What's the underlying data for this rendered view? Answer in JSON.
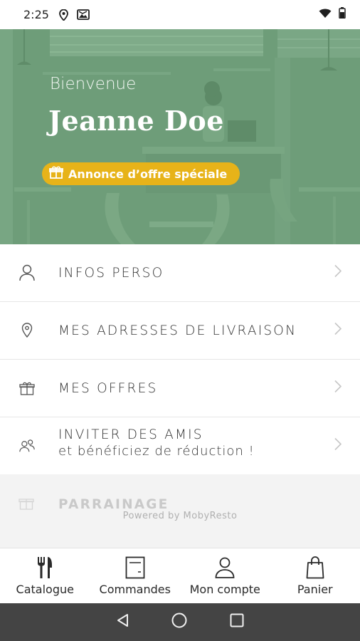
{
  "status_bar": {
    "time": "2:25",
    "icons": [
      "location-icon",
      "gallery-icon",
      "wifi-icon",
      "battery-icon"
    ]
  },
  "hero": {
    "greeting": "Bienvenue",
    "name": "Jeanne Doe",
    "offer_label": "Annonce d’offre spéciale",
    "bg_color": "#6e9d79",
    "accent_color": "#e7b319"
  },
  "menu": {
    "items": [
      {
        "label": "INFOS PERSO",
        "icon": "person-icon"
      },
      {
        "label": "MES ADRESSES DE LIVRAISON",
        "icon": "location-pin-icon"
      },
      {
        "label": "MES OFFRES",
        "icon": "gift-icon"
      },
      {
        "label": "INVITER DES AMIS",
        "sublabel": "et bénéficiez de réduction !",
        "icon": "people-icon"
      }
    ],
    "faded_label": "PARRAINAGE",
    "powered_by": "Powered by MobyResto"
  },
  "bottom_nav": {
    "items": [
      {
        "label": "Catalogue",
        "icon": "cutlery-icon"
      },
      {
        "label": "Commandes",
        "icon": "receipt-icon"
      },
      {
        "label": "Mon compte",
        "icon": "account-icon"
      },
      {
        "label": "Panier",
        "icon": "bag-icon"
      }
    ]
  }
}
